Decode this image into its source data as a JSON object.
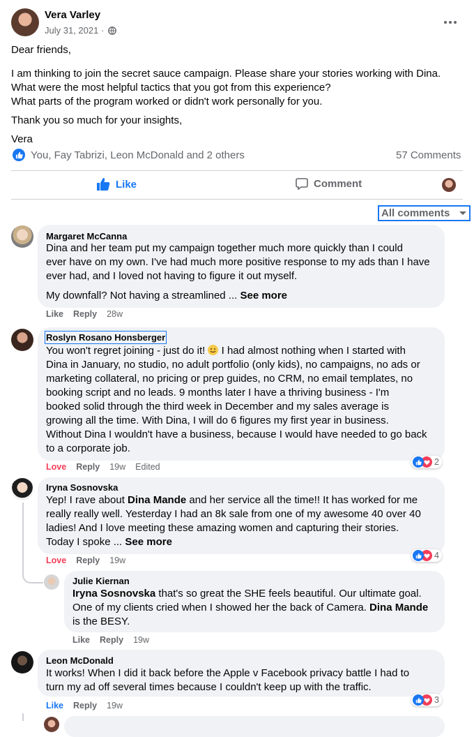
{
  "post": {
    "author": "Vera Varley",
    "date": "July 31, 2021 · ",
    "greeting": "Dear friends,",
    "line1": "I am thinking to join the secret sauce campaign.  Please share your stories working with Dina.",
    "line2": "What were the most helpful tactics that you got from this experience?",
    "line3": "What parts of the program worked or didn't work personally for you.",
    "thanks": "Thank you so much for your insights,",
    "signoff": "Vera",
    "reactions_text": "You, Fay Tabrizi, Leon McDonald and 2 others",
    "comments_count": "57 Comments",
    "like_label": "Like",
    "comment_label": "Comment",
    "filter_label": "All comments"
  },
  "comments": [
    {
      "author": "Margaret McCanna",
      "line1": "Dina and her team put my campaign together much more quickly than I could",
      "line2": "ever have on my own. I've had much more positive response to my ads than I have",
      "line3": "ever had, and I loved not having to figure it out myself.",
      "line4": "My downfall? Not having a streamlined ... ",
      "see_more": "See more",
      "action1": "Like",
      "action2": "Reply",
      "time": "28w"
    },
    {
      "author": "Roslyn Rosano Honsberger",
      "line1a": "You won't regret joining - just do it! ",
      "line1b": " I had almost nothing when I started with",
      "line2": "Dina in January, no studio, no adult portfolio (only kids), no campaigns, no ads or",
      "line3": "marketing collateral, no pricing or prep guides, no CRM, no email templates, no",
      "line4": "booking script and no leads. 9 months later I have a thriving business - I'm",
      "line5": "booked solid through the third week in December and my sales average is",
      "line6": "growing all the time. With Dina, I will do 6 figures my first year in business.",
      "line7": "Without Dina I wouldn't have a business, because I would have needed to go back",
      "line8": "to a corporate job.",
      "action1": "Love",
      "action2": "Reply",
      "time": "19w",
      "edited": "Edited",
      "reaction_count": "2"
    },
    {
      "author": "Iryna Sosnovska",
      "line1": "Yep! I rave about ",
      "mention": "Dina Mande",
      "line1b": " and her service all the time!! It has worked for me",
      "line2": "really really well. Yesterday I had an 8k sale from one of my awesome 40 over 40",
      "line3": "ladies! And I love meeting these amazing women and capturing their stories.",
      "line4": "Today I spoke ... ",
      "see_more": "See more",
      "action1": "Love",
      "action2": "Reply",
      "time": "19w",
      "reaction_count": "4"
    },
    {
      "author": "Julie Kiernan",
      "mention1": "Iryna Sosnovska",
      "line1": " that's so great the SHE feels beautiful. Our ultimate goal.",
      "line2a": "One of my clients cried when I showed her the back of Camera. ",
      "mention2": "Dina Mande",
      "line3": "is the BESY.",
      "action1": "Like",
      "action2": "Reply",
      "time": "19w"
    },
    {
      "author": "Leon McDonald",
      "line1": "It works! When I did it back before the Apple v Facebook privacy battle I had to",
      "line2": "turn my ad off several times because I couldn't keep up with the traffic.",
      "action1": "Like",
      "action2": "Reply",
      "time": "19w",
      "reaction_count": "3"
    }
  ],
  "colors": {
    "accent": "#1877f2",
    "love": "#f33e58",
    "muted": "#65676b",
    "bubble": "#f0f2f5"
  }
}
